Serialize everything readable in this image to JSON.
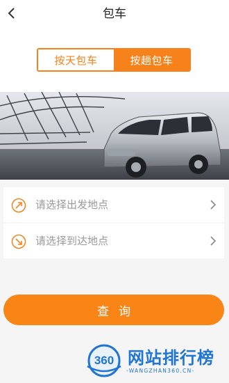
{
  "header": {
    "title": "包车",
    "back_icon": "chevron-left-icon"
  },
  "mode_tabs": [
    {
      "label": "按天包车",
      "selected": false
    },
    {
      "label": "按趟包车",
      "selected": true
    }
  ],
  "locations": {
    "departure": {
      "placeholder": "请选择出发地点",
      "icon": "arrow-up-right-icon"
    },
    "destination": {
      "placeholder": "请选择到达地点",
      "icon": "arrow-down-right-icon"
    }
  },
  "query_button": {
    "label": "查询"
  },
  "watermark": {
    "logo_text": "360",
    "title": "网站排行榜",
    "subtitle": "-WANGZHAN360.CN-"
  },
  "colors": {
    "accent": "#f7821b",
    "placeholder_text": "#9a9a9a",
    "watermark_blue": "#1f74d4"
  }
}
